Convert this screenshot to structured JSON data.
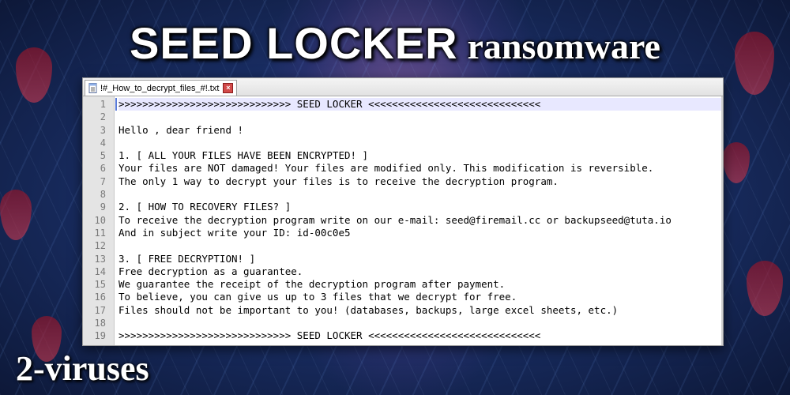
{
  "headline": {
    "strong": "SEED LOCKER",
    "weak": "ransomware"
  },
  "editor": {
    "tab_label": "!#_How_to_decrypt_files_#!.txt",
    "lines": [
      ">>>>>>>>>>>>>>>>>>>>>>>>>>>>> SEED LOCKER <<<<<<<<<<<<<<<<<<<<<<<<<<<<<",
      "",
      "Hello , dear friend !",
      "",
      "1. [ ALL YOUR FILES HAVE BEEN ENCRYPTED! ]",
      "Your files are NOT damaged! Your files are modified only. This modification is reversible.",
      "The only 1 way to decrypt your files is to receive the decryption program.",
      "",
      "2. [ HOW TO RECOVERY FILES? ]",
      "To receive the decryption program write on our e-mail: seed@firemail.cc or backupseed@tuta.io",
      "And in subject write your ID: id-00c0e5",
      "",
      "3. [ FREE DECRYPTION! ]",
      "Free decryption as a guarantee.",
      "We guarantee the receipt of the decryption program after payment.",
      "To believe, you can give us up to 3 files that we decrypt for free.",
      "Files should not be important to you! (databases, backups, large excel sheets, etc.)",
      "",
      ">>>>>>>>>>>>>>>>>>>>>>>>>>>>> SEED LOCKER <<<<<<<<<<<<<<<<<<<<<<<<<<<<<"
    ],
    "line_numbers": [
      "1",
      "2",
      "3",
      "4",
      "5",
      "6",
      "7",
      "8",
      "9",
      "10",
      "11",
      "12",
      "13",
      "14",
      "15",
      "16",
      "17",
      "18",
      "19"
    ]
  },
  "watermark": "2-viruses"
}
